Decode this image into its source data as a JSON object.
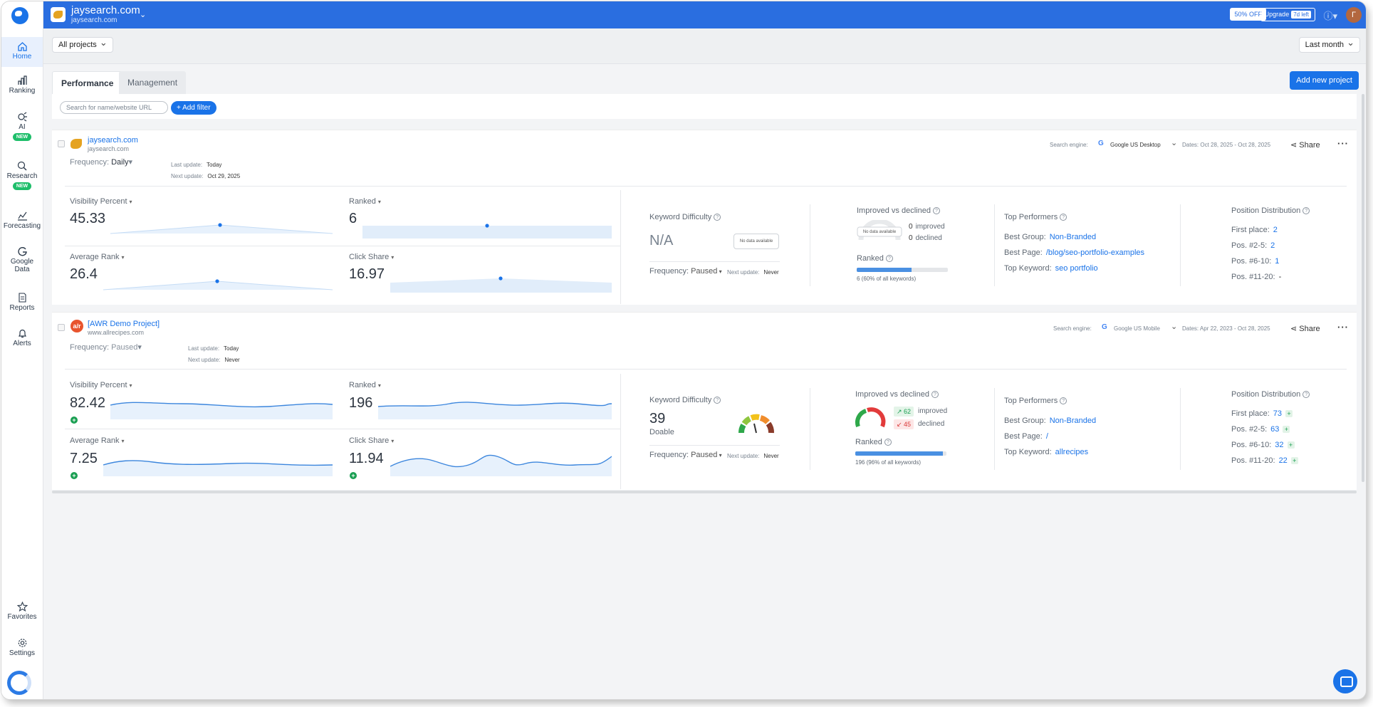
{
  "sidebar": {
    "items": [
      {
        "label": "Home"
      },
      {
        "label": "Ranking"
      },
      {
        "label": "AI",
        "badge": "NEW"
      },
      {
        "label": "Research",
        "badge": "NEW"
      },
      {
        "label": "Forecasting"
      },
      {
        "label": "Google Data"
      },
      {
        "label": "Reports"
      },
      {
        "label": "Alerts"
      }
    ],
    "bottom": [
      {
        "label": "Favorites"
      },
      {
        "label": "Settings"
      }
    ]
  },
  "topbar": {
    "site_name": "jaysearch.com",
    "site_url": "jaysearch.com",
    "discount": "50% OFF",
    "upgrade": "Upgrade",
    "upgrade_badge": "7d left",
    "avatar_letter": "Г"
  },
  "filters": {
    "projects": "All projects",
    "period": "Last month"
  },
  "tabs": [
    "Performance",
    "Management"
  ],
  "add_project": "Add new project",
  "search": {
    "placeholder": "Search for name/website URL",
    "add_filter": "Add filter"
  },
  "labels": {
    "frequency": "Frequency:",
    "last_update": "Last update:",
    "next_update": "Next update:",
    "search_engine": "Search engine:",
    "share": "Share",
    "visibility": "Visibility Percent",
    "ranked": "Ranked",
    "avg_rank": "Average Rank",
    "click_share": "Click Share",
    "kd": "Keyword Difficulty",
    "improved_vs_declined": "Improved vs declined",
    "improved": "improved",
    "declined": "declined",
    "ranked_small": "Ranked",
    "top_performers": "Top Performers",
    "best_group": "Best Group:",
    "best_page": "Best Page:",
    "top_keyword": "Top Keyword:",
    "position_distribution": "Position Distribution",
    "first_place": "First place:",
    "pos_2_5": "Pos. #2-5:",
    "pos_6_10": "Pos. #6-10:",
    "pos_11_20": "Pos. #11-20:",
    "no_data": "No data available",
    "next_update_short": "Next update:"
  },
  "projects": [
    {
      "name": "jaysearch.com",
      "url": "jaysearch.com",
      "frequency": "Daily",
      "last_update": "Today",
      "next_update": "Oct 29, 2025",
      "search_engine": "Google US Desktop",
      "dates": "Dates: Oct 28, 2025 - Oct 28, 2025",
      "visibility": "45.33",
      "ranked": "6",
      "avg_rank": "26.4",
      "click_share": "16.97",
      "kd_value": "N/A",
      "kd_frequency": "Paused",
      "kd_next": "Never",
      "improved": "0",
      "declined": "0",
      "ranked_pct": 0.6,
      "ranked_caption": "6 (60% of all keywords)",
      "best_group": "Non-Branded",
      "best_page": "/blog/seo-portfolio-examples",
      "top_keyword": "seo portfolio",
      "first_place": "2",
      "pos_2_5": "2",
      "pos_6_10": "1",
      "pos_11_20": "-"
    },
    {
      "name": "[AWR Demo Project]",
      "url": "www.allrecipes.com",
      "favicon_text": "a/r",
      "frequency": "Paused",
      "last_update": "Today",
      "next_update": "Never",
      "search_engine": "Google US Mobile",
      "dates": "Dates: Apr 22, 2023 - Oct 28, 2025",
      "visibility": "82.42",
      "ranked": "196",
      "avg_rank": "7.25",
      "click_share": "11.94",
      "kd_value": "39",
      "kd_label": "Doable",
      "kd_frequency": "Paused",
      "kd_next": "Never",
      "improved": "62",
      "declined": "45",
      "ranked_pct": 0.96,
      "ranked_caption": "196 (96% of all keywords)",
      "best_group": "Non-Branded",
      "best_page": "/",
      "top_keyword": "allrecipes",
      "first_place": "73",
      "pos_2_5": "63",
      "pos_6_10": "32",
      "pos_11_20": "22"
    }
  ],
  "colors": {
    "brand": "#2a6ee0",
    "accent": "#1a73e8",
    "positive": "#1a9f52",
    "negative": "#d93636"
  },
  "icons": [
    "home-icon",
    "ranking-icon",
    "ai-icon",
    "research-icon",
    "forecasting-icon",
    "google-data-icon",
    "reports-icon",
    "alerts-icon",
    "favorites-icon",
    "settings-icon",
    "share-icon",
    "help-icon",
    "chat-icon"
  ]
}
